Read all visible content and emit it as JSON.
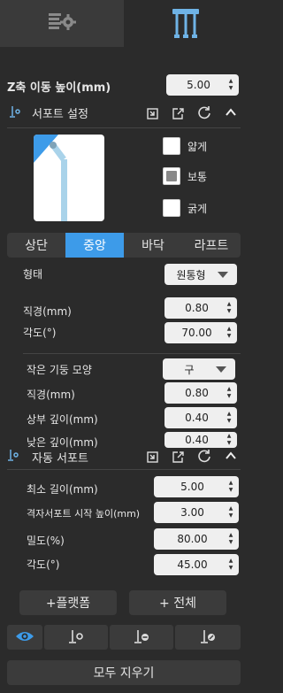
{
  "tabs": {
    "left_icon": "settings-list-icon",
    "right_icon": "support-structure-icon"
  },
  "z_move": {
    "label": "Z축 이동 높이(mm)",
    "value": "5.00"
  },
  "support_settings": {
    "title": "서포트 설정",
    "thickness_options": [
      {
        "label": "얇게",
        "checked": false
      },
      {
        "label": "보통",
        "checked": true
      },
      {
        "label": "굵게",
        "checked": false
      }
    ],
    "segments": [
      "상단",
      "중앙",
      "바닥",
      "라프트"
    ],
    "active_segment": "중앙",
    "shape": {
      "label": "형태",
      "value": "원통형"
    },
    "diameter": {
      "label": "직경(mm)",
      "value": "0.80"
    },
    "angle": {
      "label": "각도(°)",
      "value": "70.00"
    },
    "small_pillar": {
      "label": "작은 기둥 모양",
      "value": "구"
    },
    "small_diameter": {
      "label": "직경(mm)",
      "value": "0.80"
    },
    "top_depth": {
      "label": "상부 깊이(mm)",
      "value": "0.40"
    },
    "low_depth": {
      "label": "낮은 깊이(mm)",
      "value": "0.40"
    }
  },
  "auto_support": {
    "title": "자동 서포트",
    "min_length": {
      "label": "최소 길이(mm)",
      "value": "5.00"
    },
    "grid_start_height": {
      "label": "격자서포트 시작 높이(mm)",
      "value": "3.00"
    },
    "density": {
      "label": "밀도(%)",
      "value": "80.00"
    },
    "angle": {
      "label": "각도(°)",
      "value": "45.00"
    }
  },
  "buttons": {
    "platform": "+플랫폼",
    "all": "+ 전체",
    "clear_all": "모두 지우기"
  },
  "colors": {
    "accent": "#3d9be9",
    "panel": "#2b2b2b"
  }
}
